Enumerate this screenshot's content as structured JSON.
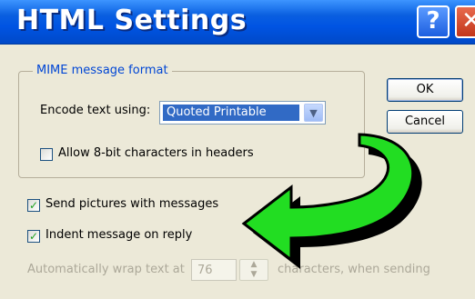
{
  "window": {
    "title": "HTML Settings",
    "help_glyph": "?",
    "close_glyph": "✕",
    "accent_color": "#0054e3"
  },
  "mime_group": {
    "title": "MIME message format",
    "encode_label": "Encode text using:",
    "encode_value": "Quoted Printable",
    "allow_8bit_label": "Allow 8-bit characters in headers",
    "allow_8bit_checked": false
  },
  "buttons": {
    "ok": "OK",
    "cancel": "Cancel"
  },
  "options": {
    "send_pictures_label": "Send pictures with messages",
    "send_pictures_checked": true,
    "indent_label": "Indent message on reply",
    "indent_checked": true
  },
  "wrap": {
    "prefix_label": "Automatically wrap text at",
    "value": "76",
    "suffix_label": "characters, when sending"
  },
  "overlay": {
    "arrow_color": "#22dd22",
    "arrow_outline": "#000000"
  }
}
